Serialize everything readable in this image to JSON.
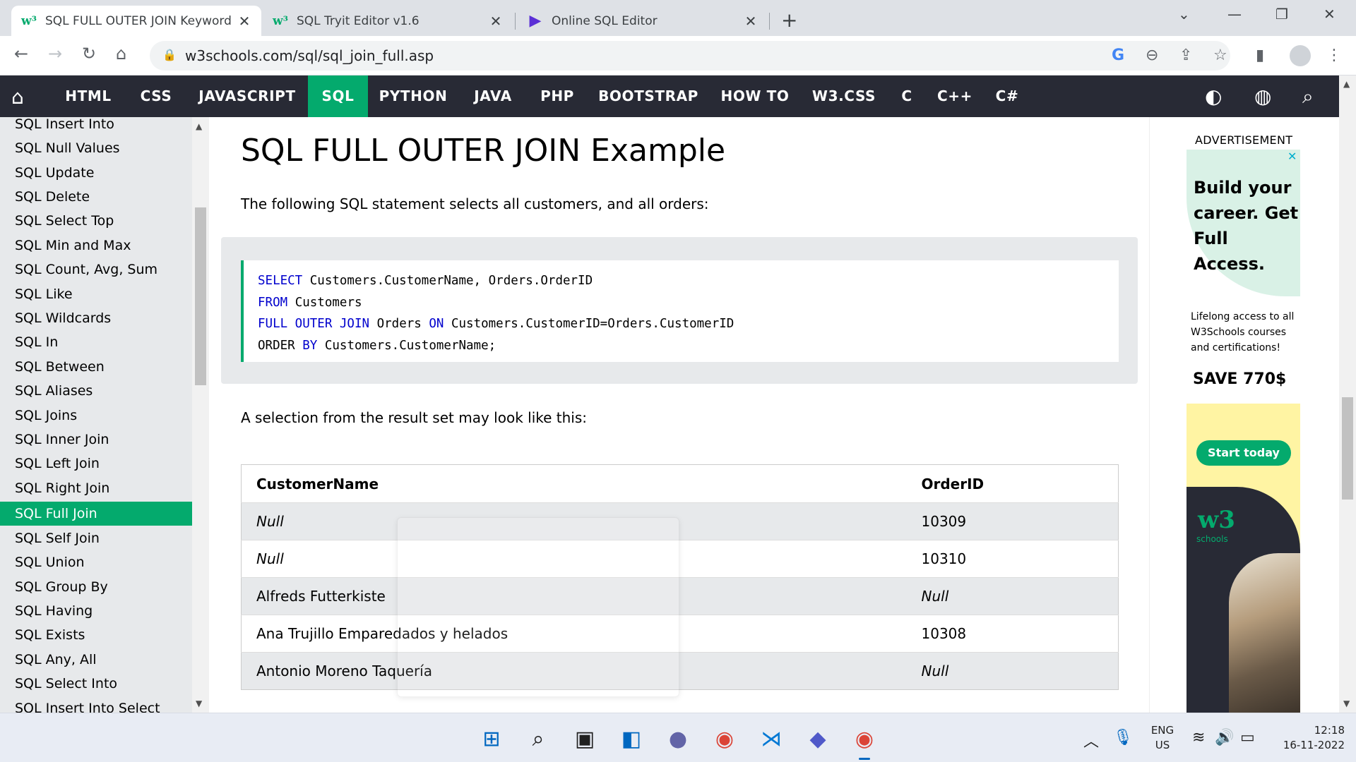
{
  "browser": {
    "tabs": [
      {
        "label": "SQL FULL OUTER JOIN Keyword",
        "active": true
      },
      {
        "label": "SQL Tryit Editor v1.6",
        "active": false
      },
      {
        "label": "Online SQL Editor",
        "active": false
      }
    ],
    "url": "w3schools.com/sql/sql_join_full.asp"
  },
  "topnav": {
    "items": [
      "HTML",
      "CSS",
      "JAVASCRIPT",
      "SQL",
      "PYTHON",
      "JAVA",
      "PHP",
      "BOOTSTRAP",
      "HOW TO",
      "W3.CSS",
      "C",
      "C++",
      "C#"
    ],
    "active": "SQL"
  },
  "sidebar": {
    "items": [
      "SQL Insert Into",
      "SQL Null Values",
      "SQL Update",
      "SQL Delete",
      "SQL Select Top",
      "SQL Min and Max",
      "SQL Count, Avg, Sum",
      "SQL Like",
      "SQL Wildcards",
      "SQL In",
      "SQL Between",
      "SQL Aliases",
      "SQL Joins",
      "SQL Inner Join",
      "SQL Left Join",
      "SQL Right Join",
      "SQL Full Join",
      "SQL Self Join",
      "SQL Union",
      "SQL Group By",
      "SQL Having",
      "SQL Exists",
      "SQL Any, All",
      "SQL Select Into",
      "SQL Insert Into Select"
    ],
    "active": "SQL Full Join"
  },
  "main": {
    "title": "SQL FULL OUTER JOIN Example",
    "intro": "The following SQL statement selects all customers, and all orders:",
    "code": {
      "line1": {
        "kw": "SELECT",
        "rest": " Customers.CustomerName, Orders.OrderID"
      },
      "line2": {
        "kw": "FROM",
        "rest": " Customers"
      },
      "line3": {
        "kw1": "FULL OUTER JOIN",
        "mid": " Orders ",
        "kw2": "ON",
        "rest": " Customers.CustomerID=Orders.CustomerID"
      },
      "line4": {
        "pre": "ORDER ",
        "kw": "BY",
        "rest": " Customers.CustomerName;"
      }
    },
    "result_intro": "A selection from the result set may look like this:",
    "table": {
      "headers": [
        "CustomerName",
        "OrderID"
      ],
      "rows": [
        [
          "Null",
          "10309"
        ],
        [
          "Null",
          "10310"
        ],
        [
          "Alfreds Futterkiste",
          "Null"
        ],
        [
          "Ana Trujillo Emparedados y helados",
          "10308"
        ],
        [
          "Antonio Moreno Taquería",
          "Null"
        ]
      ]
    }
  },
  "ad": {
    "label": "ADVERTISEMENT",
    "headline": "Build your career. Get Full Access.",
    "sub": "Lifelong access to all W3Schools courses and certifications!",
    "save": "SAVE 770$",
    "button": "Start today",
    "logo": "w3",
    "logo_sub": "schools"
  },
  "taskbar": {
    "lang_top": "ENG",
    "lang_bottom": "US",
    "time": "12:18",
    "date": "16-11-2022"
  },
  "colors": {
    "accent": "#04aa6d",
    "nav_bg": "#282a35",
    "sidebar_bg": "#e7e9eb",
    "keyword": "#0000cd"
  }
}
